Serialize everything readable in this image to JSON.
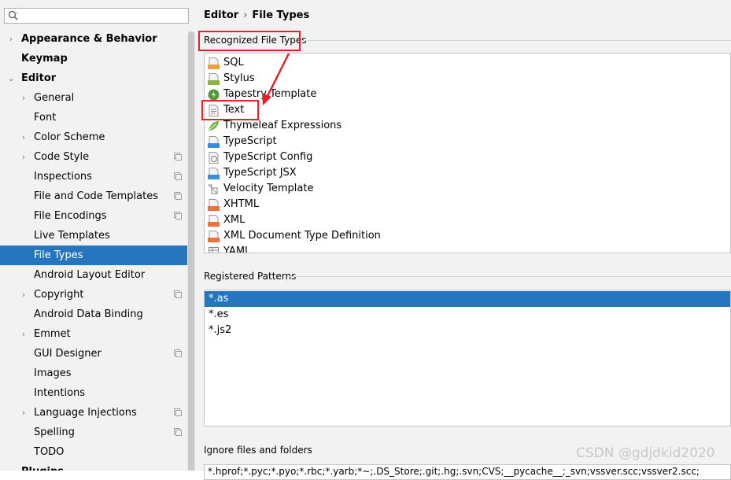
{
  "search": {
    "placeholder": ""
  },
  "sidebar": {
    "items": [
      {
        "label": "Appearance & Behavior",
        "bold": true,
        "chevron": "›"
      },
      {
        "label": "Keymap",
        "bold": true,
        "chevron": ""
      },
      {
        "label": "Editor",
        "bold": true,
        "chevron": "⌄"
      },
      {
        "label": "General",
        "chevron": "›"
      },
      {
        "label": "Font",
        "chevron": ""
      },
      {
        "label": "Color Scheme",
        "chevron": "›"
      },
      {
        "label": "Code Style",
        "chevron": "›",
        "project": true
      },
      {
        "label": "Inspections",
        "chevron": "",
        "project": true
      },
      {
        "label": "File and Code Templates",
        "chevron": "",
        "project": true
      },
      {
        "label": "File Encodings",
        "chevron": "",
        "project": true
      },
      {
        "label": "Live Templates",
        "chevron": ""
      },
      {
        "label": "File Types",
        "chevron": "",
        "selected": true
      },
      {
        "label": "Android Layout Editor",
        "chevron": ""
      },
      {
        "label": "Copyright",
        "chevron": "›",
        "project": true
      },
      {
        "label": "Android Data Binding",
        "chevron": ""
      },
      {
        "label": "Emmet",
        "chevron": "›"
      },
      {
        "label": "GUI Designer",
        "chevron": "",
        "project": true
      },
      {
        "label": "Images",
        "chevron": ""
      },
      {
        "label": "Intentions",
        "chevron": ""
      },
      {
        "label": "Language Injections",
        "chevron": "›",
        "project": true
      },
      {
        "label": "Spelling",
        "chevron": "",
        "project": true
      },
      {
        "label": "TODO",
        "chevron": ""
      },
      {
        "label": "Plugins",
        "bold": true,
        "chevron": ""
      }
    ]
  },
  "breadcrumb": {
    "parent": "Editor",
    "separator": "›",
    "current": "File Types"
  },
  "recognized": {
    "title": "Recognized File Types",
    "items": [
      {
        "label": "SQL",
        "icon": "sql-file-icon",
        "tag": "SQL",
        "color": "#e8a33d"
      },
      {
        "label": "Stylus",
        "icon": "stylus-file-icon",
        "tag": "STYL",
        "color": "#8ab33f"
      },
      {
        "label": "Tapestry Template",
        "icon": "tapestry-icon",
        "tag": "",
        "color": "#4c9a3c"
      },
      {
        "label": "Text",
        "icon": "text-file-icon",
        "tag": "",
        "color": "#888888"
      },
      {
        "label": "Thymeleaf Expressions",
        "icon": "thymeleaf-icon",
        "tag": "",
        "color": "#6cb33e"
      },
      {
        "label": "TypeScript",
        "icon": "typescript-file-icon",
        "tag": "TS",
        "color": "#3c8fd1"
      },
      {
        "label": "TypeScript Config",
        "icon": "typescript-config-icon",
        "tag": "{}",
        "color": "#777777"
      },
      {
        "label": "TypeScript JSX",
        "icon": "tsx-file-icon",
        "tag": "TSX",
        "color": "#3c8fd1"
      },
      {
        "label": "Velocity Template",
        "icon": "velocity-icon",
        "tag": "",
        "color": "#999999"
      },
      {
        "label": "XHTML",
        "icon": "xhtml-file-icon",
        "tag": "H",
        "color": "#e8743d"
      },
      {
        "label": "XML",
        "icon": "xml-file-icon",
        "tag": "<>",
        "color": "#e8743d"
      },
      {
        "label": "XML Document Type Definition",
        "icon": "dtd-file-icon",
        "tag": "DTD",
        "color": "#e8743d"
      },
      {
        "label": "YAML",
        "icon": "yaml-file-icon",
        "tag": "",
        "color": "#888888"
      }
    ]
  },
  "patterns": {
    "title": "Registered Patterns",
    "items": [
      {
        "label": "*.as",
        "selected": true
      },
      {
        "label": "*.es"
      },
      {
        "label": "*.js2"
      }
    ]
  },
  "ignore": {
    "title": "Ignore files and folders",
    "value": "*.hprof;*.pyc;*.pyo;*.rbc;*.yarb;*~;.DS_Store;.git;.hg;.svn;CVS;__pycache__;_svn;vssver.scc;vssver2.scc;"
  },
  "watermark": "CSDN @gdjdkid2020",
  "colors": {
    "selection": "#2675bf",
    "annotation": "#e8202a"
  }
}
